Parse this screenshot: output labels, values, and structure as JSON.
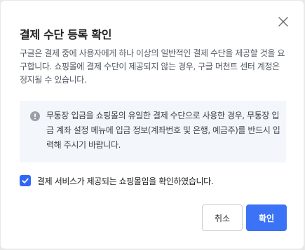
{
  "dialog": {
    "title": "결제 수단 등록 확인",
    "description": "구글은 결제 중에 사용자에게 하나 이상의 일반적인 결제 수단을 제공할 것을 요구합니다. 쇼핑몰에 결제 수단이 제공되지 않는 경우, 구글 머천트 센터 계정은 정지될 수 있습니다.",
    "notice": "무통장 입금을 쇼핑몰의 유일한 결제 수단으로 사용한 경우, 무통장 입금 계좌 설정 메뉴에 입금 정보(계좌번호 및 은행, 예금주)를 반드시 입력해 주시기 바랍니다.",
    "confirm_checkbox": {
      "label": "결제 서비스가 제공되는 쇼핑몰임을 확인하였습니다.",
      "checked": true
    },
    "cancel_label": "취소",
    "ok_label": "확인"
  },
  "colors": {
    "accent": "#3b72f6",
    "notice_background": "#f3f6fb",
    "backdrop": "#e9e9ea"
  },
  "icons": {
    "close": "close-icon",
    "notice": "info-icon",
    "check": "check-icon"
  }
}
